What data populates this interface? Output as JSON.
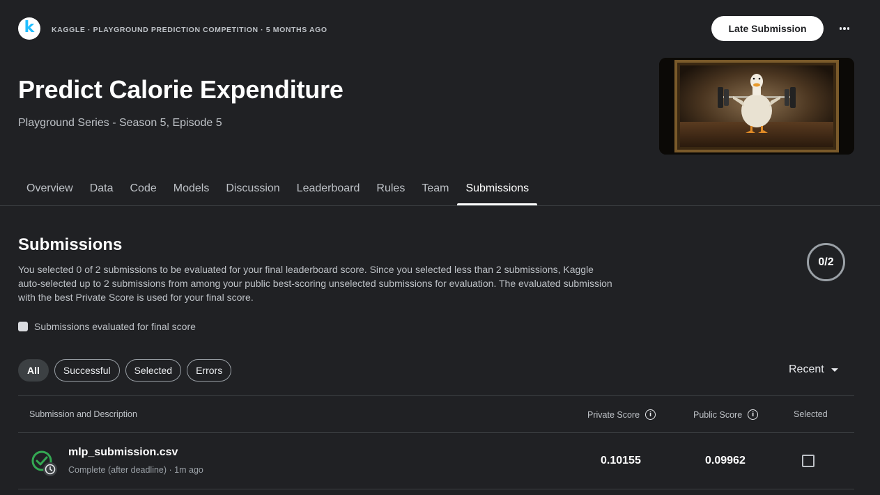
{
  "header": {
    "logo_letter": "k",
    "meta": "KAGGLE · PLAYGROUND PREDICTION COMPETITION · 5 MONTHS AGO",
    "late_submission_label": "Late Submission",
    "more_icon": "more-horizontal-icon"
  },
  "competition": {
    "title": "Predict Calorie Expenditure",
    "subtitle": "Playground Series - Season 5, Episode 5"
  },
  "tabs": [
    {
      "label": "Overview"
    },
    {
      "label": "Data"
    },
    {
      "label": "Code"
    },
    {
      "label": "Models"
    },
    {
      "label": "Discussion"
    },
    {
      "label": "Leaderboard"
    },
    {
      "label": "Rules"
    },
    {
      "label": "Team"
    },
    {
      "label": "Submissions",
      "active": true
    }
  ],
  "submissions": {
    "heading": "Submissions",
    "description": "You selected 0 of 2 submissions to be evaluated for your final leaderboard score. Since you selected less than 2 submissions, Kaggle auto-selected up to 2 submissions from among your public best-scoring unselected submissions for evaluation. The evaluated submission with the best Private Score is used for your final score.",
    "counter": "0/2",
    "evaluated_filter_label": "Submissions evaluated for final score",
    "filters": [
      {
        "label": "All",
        "active": true
      },
      {
        "label": "Successful"
      },
      {
        "label": "Selected"
      },
      {
        "label": "Errors"
      }
    ],
    "sort_label": "Recent"
  },
  "table": {
    "headers": {
      "submission": "Submission and Description",
      "private": "Private Score",
      "public": "Public Score",
      "selected": "Selected"
    },
    "rows": [
      {
        "file": "mlp_submission.csv",
        "status": "Complete (after deadline) · 1m ago",
        "private_score": "0.10155",
        "public_score": "0.09962",
        "selected": false,
        "status_icon": "check-circle-clock-icon"
      }
    ]
  },
  "colors": {
    "background": "#202124",
    "kaggle_blue": "#20beff",
    "success_green": "#34a853"
  }
}
